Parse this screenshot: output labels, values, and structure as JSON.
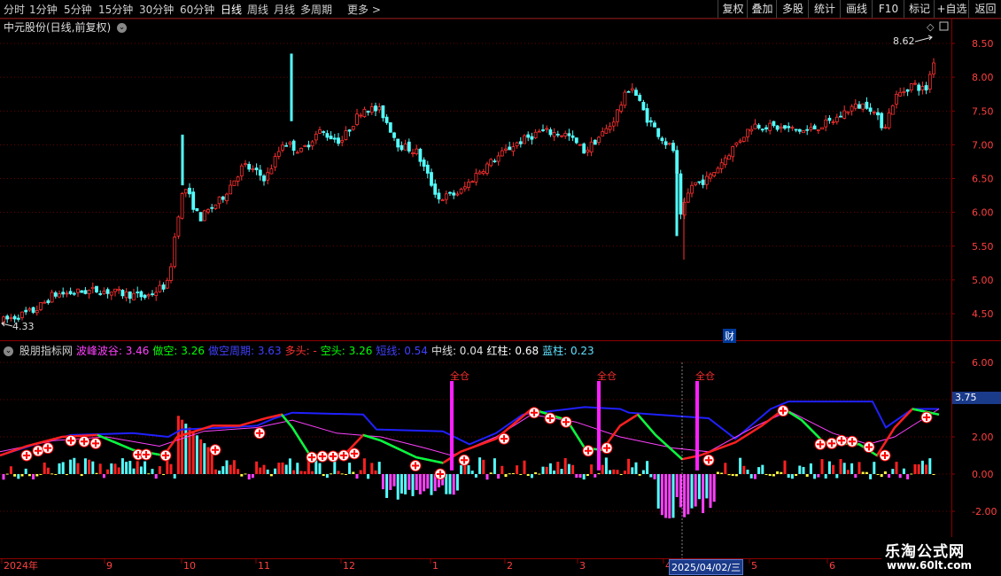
{
  "toolbar": {
    "periods": [
      "分时",
      "1分钟",
      "5分钟",
      "15分钟",
      "30分钟",
      "60分钟",
      "日线",
      "周线",
      "月线",
      "多周期",
      "更多 >"
    ],
    "active_period": "日线",
    "right_buttons": [
      "复权",
      "叠加",
      "多股",
      "统计",
      "画线",
      "F10",
      "标记",
      "+自选",
      "返回"
    ]
  },
  "title": "中元股份(日线,前复权)",
  "price_axis": [
    "8.50",
    "8.00",
    "7.50",
    "7.00",
    "6.50",
    "6.00",
    "5.50",
    "5.00",
    "4.50"
  ],
  "indicator_axis": [
    "6.00",
    "4.00",
    "2.00",
    "0.00",
    "-2.00"
  ],
  "indicator_value_tag": "3.75",
  "high_label": "8.62",
  "low_label": "4.33",
  "cai_label": "财",
  "indicator_legend": [
    {
      "text": "股朋指标网",
      "color": "#d0d0d0"
    },
    {
      "text": "波峰波谷: 3.46",
      "color": "#ff40ff"
    },
    {
      "text": "做空: 3.26",
      "color": "#00ff00"
    },
    {
      "text": "做空周期: 3.63",
      "color": "#4040ff"
    },
    {
      "text": "多头: -",
      "color": "#ff3030"
    },
    {
      "text": "空头: 3.26",
      "color": "#00ff00"
    },
    {
      "text": "短线: 0.54",
      "color": "#4040ff"
    },
    {
      "text": "中线: 0.04",
      "color": "#e0e0e0"
    },
    {
      "text": "红柱: 0.68",
      "color": "#ffffff"
    },
    {
      "text": "蓝柱: 0.23",
      "color": "#60e0ff"
    }
  ],
  "signal_label": "全仓",
  "time_axis": [
    "2024年",
    "9",
    "10",
    "11",
    "12",
    "1",
    "2",
    "3",
    "4",
    "5",
    "6"
  ],
  "date_tag": "2025/04/02/三",
  "logo": {
    "title": "乐淘公式网",
    "url": "www.60lt.com"
  },
  "colors": {
    "up": "#ff3030",
    "down": "#54ffff",
    "grid": "#8b0000"
  }
}
